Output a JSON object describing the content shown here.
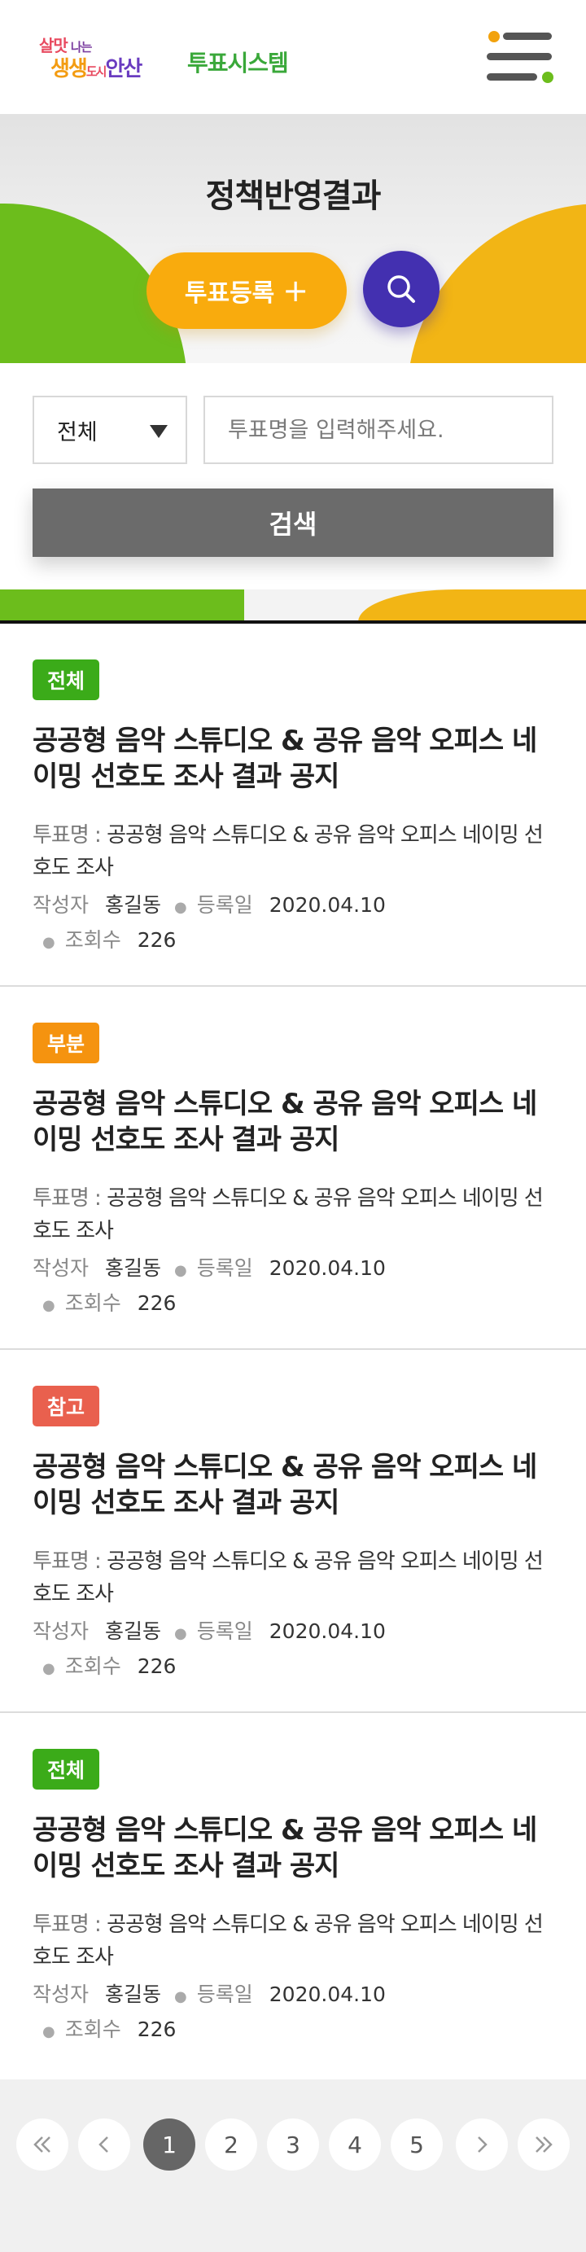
{
  "header": {
    "logo_line1_a": "살맛",
    "logo_line1_b": "나는",
    "logo_line2_a": "생생",
    "logo_line2_b": "도시",
    "logo_line2_c": "안산",
    "app_name": "투표시스템",
    "menu_icon": "hamburger-menu-icon"
  },
  "hero": {
    "title": "정책반영결과",
    "vote_button_label": "투표등록",
    "vote_button_icon": "+",
    "search_icon": "search-icon"
  },
  "search": {
    "select_value": "전체",
    "input_placeholder": "투표명을 입력해주세요.",
    "input_value": "",
    "button_label": "검색"
  },
  "list": {
    "items": [
      {
        "badge": "전체",
        "badge_color": "#3bab19",
        "title": "공공형 음악 스튜디오 & 공유 음악 오피스 네이밍 선호도 조사 결과 공지",
        "desc_label": "투표명 :",
        "desc_value": "공공형 음악 스튜디오 & 공유 음악 오피스 네이밍 선호도 조사",
        "author_label": "작성자",
        "author": "홍길동",
        "date_label": "등록일",
        "date": "2020.04.10",
        "views_label": "조회수",
        "views": "226"
      },
      {
        "badge": "부분",
        "badge_color": "#f5930f",
        "title": "공공형 음악 스튜디오 & 공유 음악 오피스 네이밍 선호도 조사 결과 공지",
        "desc_label": "투표명 :",
        "desc_value": "공공형 음악 스튜디오 & 공유 음악 오피스 네이밍 선호도 조사",
        "author_label": "작성자",
        "author": "홍길동",
        "date_label": "등록일",
        "date": "2020.04.10",
        "views_label": "조회수",
        "views": "226"
      },
      {
        "badge": "참고",
        "badge_color": "#e9604e",
        "title": "공공형 음악 스튜디오 & 공유 음악 오피스 네이밍 선호도 조사 결과 공지",
        "desc_label": "투표명 :",
        "desc_value": "공공형 음악 스튜디오 & 공유 음악 오피스 네이밍 선호도 조사",
        "author_label": "작성자",
        "author": "홍길동",
        "date_label": "등록일",
        "date": "2020.04.10",
        "views_label": "조회수",
        "views": "226"
      },
      {
        "badge": "전체",
        "badge_color": "#3bab19",
        "title": "공공형 음악 스튜디오 & 공유 음악 오피스 네이밍 선호도 조사 결과 공지",
        "desc_label": "투표명 :",
        "desc_value": "공공형 음악 스튜디오 & 공유 음악 오피스 네이밍 선호도 조사",
        "author_label": "작성자",
        "author": "홍길동",
        "date_label": "등록일",
        "date": "2020.04.10",
        "views_label": "조회수",
        "views": "226"
      }
    ]
  },
  "pagination": {
    "first_icon": "double-chevron-left-icon",
    "prev_icon": "chevron-left-icon",
    "pages": [
      "1",
      "2",
      "3",
      "4",
      "5"
    ],
    "current_page": "1",
    "next_icon": "chevron-right-icon",
    "last_icon": "double-chevron-right-icon"
  },
  "colors": {
    "accent_green": "#6cbd1c",
    "accent_yellow": "#f2b515",
    "vote_button": "#f9ab0d",
    "search_circle": "#4330b0",
    "search_button": "#6b6b6b"
  }
}
